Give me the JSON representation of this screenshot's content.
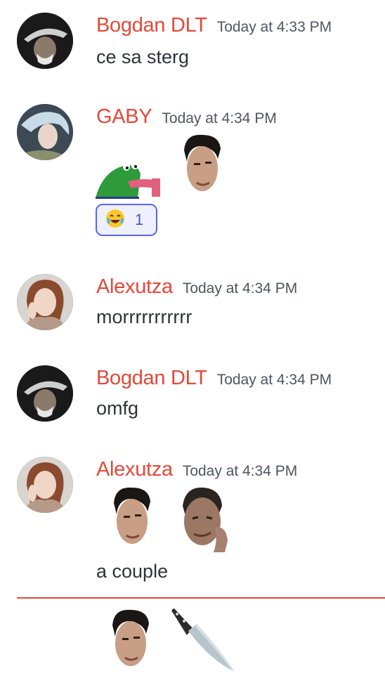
{
  "messages": [
    {
      "author": "Bogdan DLT",
      "timestamp": "Today at 4:33 PM",
      "text": "ce sa sterg"
    },
    {
      "author": "GABY",
      "timestamp": "Today at 4:34 PM",
      "emotes": [
        "frog-emote",
        "face-emote"
      ],
      "reaction": {
        "emoji": "joy-emoji",
        "count": "1"
      }
    },
    {
      "author": "Alexutza",
      "timestamp": "Today at 4:34 PM",
      "text": "morrrrrrrrrrr"
    },
    {
      "author": "Bogdan DLT",
      "timestamp": "Today at 4:34 PM",
      "text": "omfg"
    },
    {
      "author": "Alexutza",
      "timestamp": "Today at 4:34 PM",
      "emotes": [
        "face-emote",
        "thinking-face-emote"
      ],
      "text": "a couple"
    }
  ],
  "new_messages_divider": {
    "color": "#e5483a"
  },
  "last_row": {
    "emotes": [
      "face-emote",
      "knife-emoji"
    ]
  },
  "colors": {
    "author": "#e5483a",
    "timestamp": "#4f5660",
    "text": "#2e3338",
    "reaction_border": "#5865f2"
  }
}
